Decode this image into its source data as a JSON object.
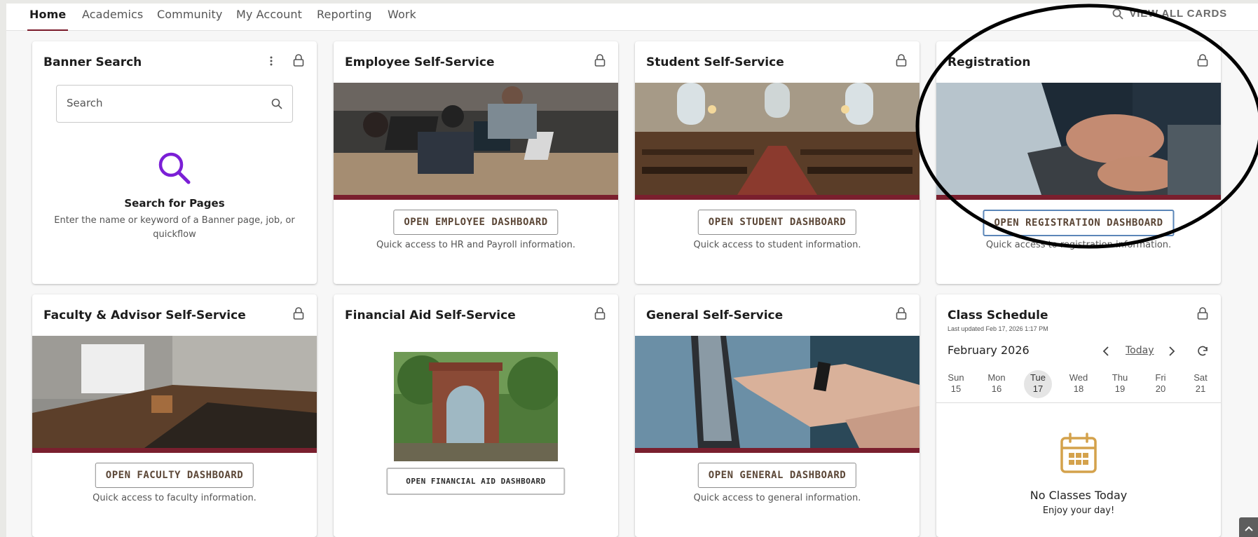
{
  "nav": {
    "tabs": [
      "Home",
      "Academics",
      "Community",
      "My Account",
      "Reporting",
      "Work"
    ],
    "active_tab": "Home",
    "view_all_label": "VIEW ALL CARDS",
    "view_all_icon": "search-icon"
  },
  "banner_search": {
    "title": "Banner Search",
    "placeholder": "Search",
    "heading": "Search for Pages",
    "description": "Enter the name or keyword of a Banner page, job, or quickflow",
    "accent_color": "#7b1fd6"
  },
  "cards": [
    {
      "id": "employee",
      "title": "Employee Self-Service",
      "button": "OPEN EMPLOYEE DASHBOARD",
      "description": "Quick access to HR and Payroll information."
    },
    {
      "id": "student",
      "title": "Student Self-Service",
      "button": "OPEN STUDENT DASHBOARD",
      "description": "Quick access to student information."
    },
    {
      "id": "registration",
      "title": "Registration",
      "button": "OPEN REGISTRATION DASHBOARD",
      "description": "Quick access to registration information."
    },
    {
      "id": "faculty",
      "title": "Faculty & Advisor Self-Service",
      "button": "OPEN FACULTY DASHBOARD",
      "description": "Quick access to faculty information."
    },
    {
      "id": "financial_aid",
      "title": "Financial Aid Self-Service",
      "button": "OPEN FINANCIAL AID DASHBOARD",
      "description": ""
    },
    {
      "id": "general",
      "title": "General Self-Service",
      "button": "OPEN GENERAL DASHBOARD",
      "description": "Quick access to general information."
    }
  ],
  "class_schedule": {
    "title": "Class Schedule",
    "last_updated": "Last updated Feb 17, 2026 1:17 PM",
    "month": "February 2026",
    "today_label": "Today",
    "days": [
      {
        "name": "Sun",
        "num": "15"
      },
      {
        "name": "Mon",
        "num": "16"
      },
      {
        "name": "Tue",
        "num": "17"
      },
      {
        "name": "Wed",
        "num": "18"
      },
      {
        "name": "Thu",
        "num": "19"
      },
      {
        "name": "Fri",
        "num": "20"
      },
      {
        "name": "Sat",
        "num": "21"
      }
    ],
    "selected_day": "17",
    "empty_title": "No Classes Today",
    "empty_sub": "Enjoy your day!",
    "calendar_color": "#d4a24c"
  },
  "colors": {
    "brand_maroon": "#7a1f2e",
    "button_text": "#5b4636",
    "highlight_button_border": "#5b86b8"
  }
}
